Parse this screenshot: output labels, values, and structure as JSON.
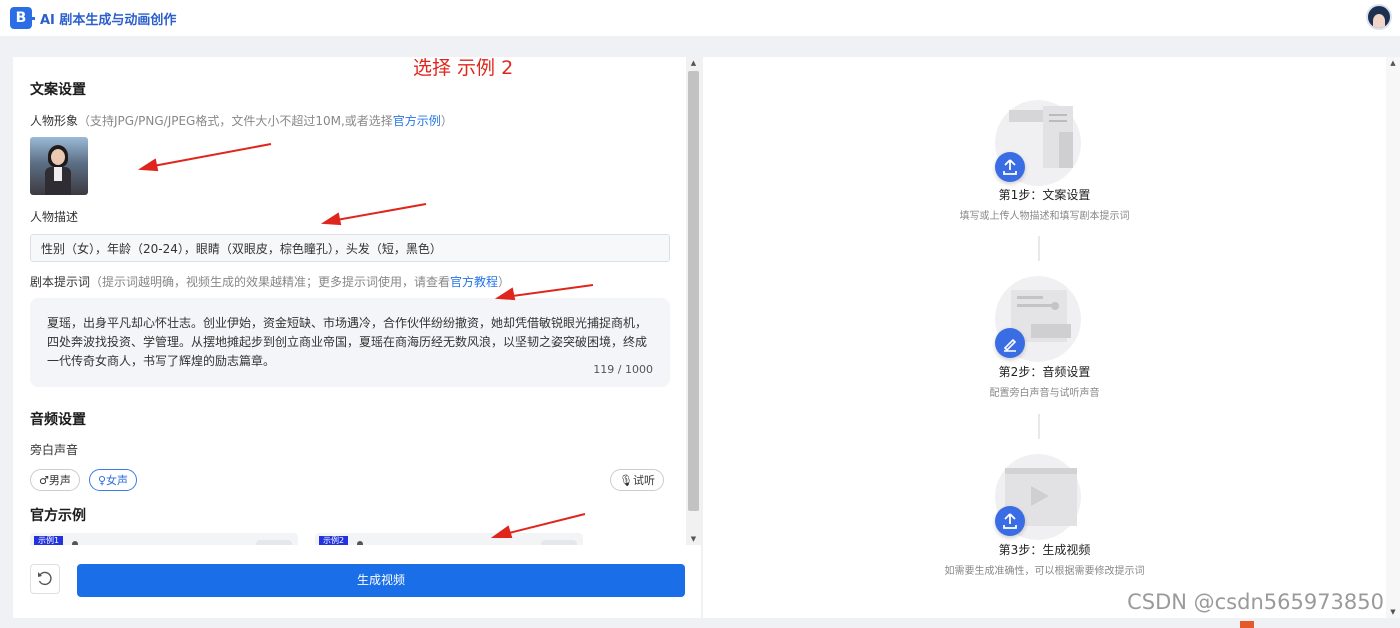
{
  "app": {
    "logo_letter": "B",
    "title": "AI 剧本生成与动画创作"
  },
  "annotation": "选择 示例 2",
  "copy_settings": {
    "title": "文案设置",
    "character_image": {
      "label": "人物形象",
      "hint": "（支持JPG/PNG/JPEG格式，文件大小不超过10M,或者选择",
      "link": "官方示例",
      "hint_end": "）"
    },
    "character_desc": {
      "label": "人物描述",
      "value": "性别（女），年龄（20-24），眼睛（双眼皮，棕色瞳孔），头发（短，黑色）"
    },
    "script_prompt": {
      "label": "剧本提示词",
      "hint": "（提示词越明确，视频生成的效果越精准；更多提示词使用，请查看",
      "link": "官方教程",
      "hint_end": "）",
      "value": "夏瑶，出身平凡却心怀壮志。创业伊始，资金短缺、市场遇冷，合作伙伴纷纷撤资，她却凭借敏锐眼光捕捉商机，四处奔波找投资、学管理。从摆地摊起步到创立商业帝国，夏瑶在商海历经无数风浪，以坚韧之姿突破困境，终成一代传奇女商人，书写了辉煌的励志篇章。",
      "count": "119 / 1000"
    }
  },
  "audio_settings": {
    "title": "音频设置",
    "narration_label": "旁白声音",
    "male": "♂男声",
    "female": "♀女声",
    "trial": "试听",
    "selected": "女声"
  },
  "official_examples": {
    "title": "官方示例",
    "items": [
      {
        "badge": "示例1"
      },
      {
        "badge": "示例2"
      }
    ]
  },
  "actions": {
    "generate": "生成视频"
  },
  "steps": [
    {
      "prefix": "第",
      "num": "1",
      "suffix": "步：文案设置",
      "desc": "填写或上传人物描述和填写剧本提示词"
    },
    {
      "prefix": "第",
      "num": "2",
      "suffix": "步：音频设置",
      "desc": "配置旁白声音与试听声音"
    },
    {
      "prefix": "第",
      "num": "3",
      "suffix": "步：生成视频",
      "desc": "如需要生成准确性，可以根据需要修改提示词"
    }
  ],
  "watermark": "CSDN @csdn565973850",
  "colors": {
    "primary": "#1a6fe8",
    "link": "#2575e8",
    "annotation": "#e0251c"
  }
}
